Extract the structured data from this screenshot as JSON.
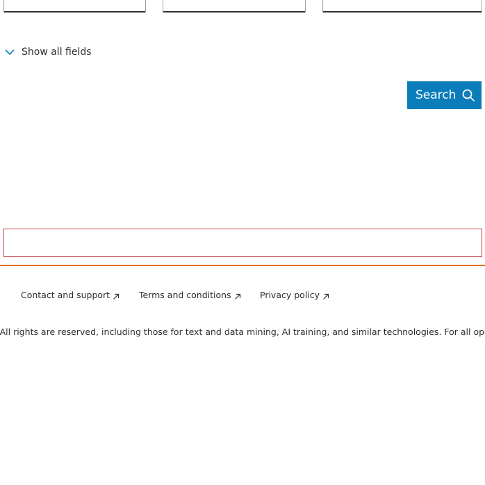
{
  "form": {
    "show_all_label": "Show all fields",
    "search_label": "Search"
  },
  "footer": {
    "links": [
      {
        "label": "Contact and support"
      },
      {
        "label": "Terms and conditions"
      },
      {
        "label": "Privacy policy"
      }
    ],
    "copyright": "rs. All rights are reserved, including those for text and data mining, AI training, and similar technologies. For all open ac"
  },
  "colors": {
    "accent": "#0c7dbb",
    "error_border": "#c0393b",
    "footer_rule": "#e07014"
  },
  "icons": {
    "toggle": "chevron-down-icon",
    "search": "search-icon",
    "external": "external-link-arrow-icon"
  }
}
